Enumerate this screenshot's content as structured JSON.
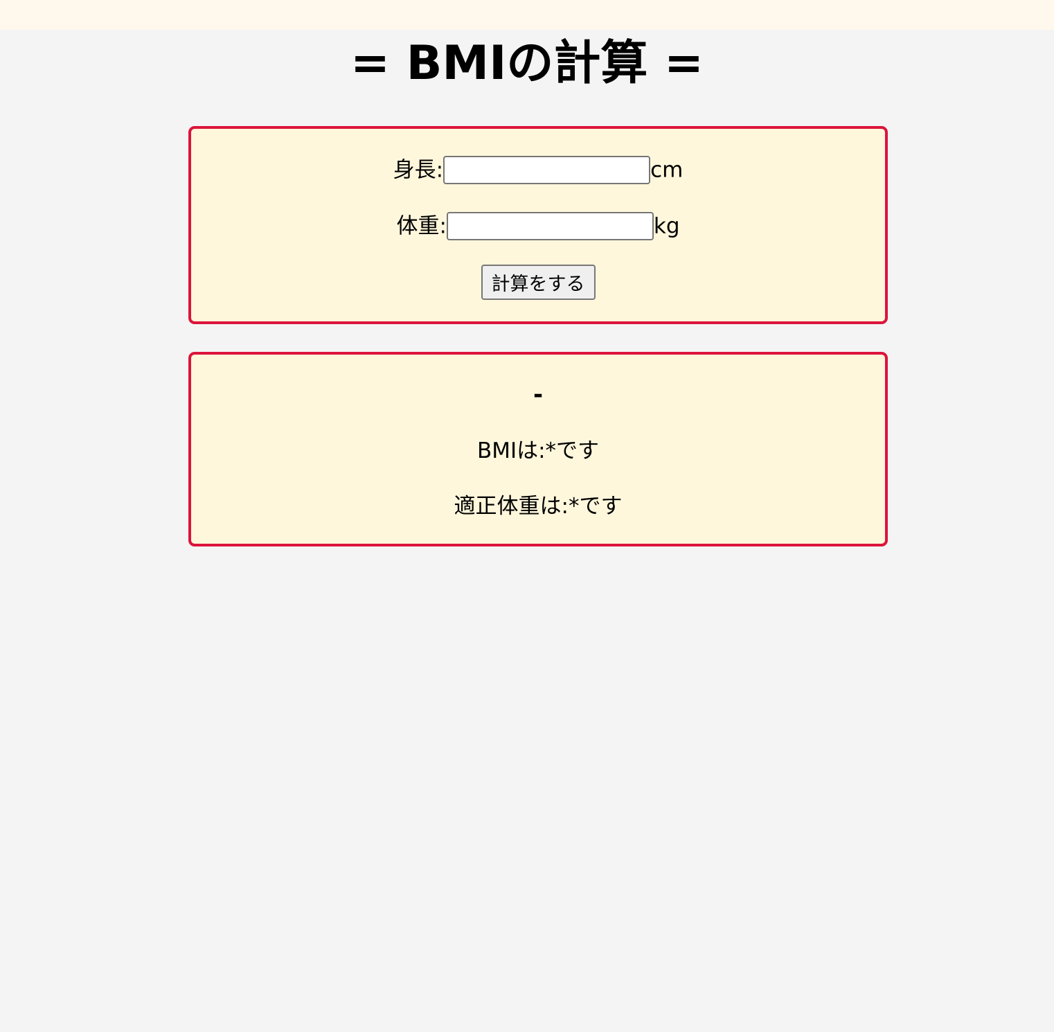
{
  "page": {
    "title": "= BMIの計算 ="
  },
  "form": {
    "height_label": "身長:",
    "height_value": "",
    "height_unit": "cm",
    "weight_label": "体重:",
    "weight_value": "",
    "weight_unit": "kg",
    "submit_label": "計算をする"
  },
  "result": {
    "status": "-",
    "bmi_text": "BMIは:*です",
    "ideal_weight_text": "適正体重は:*です"
  },
  "colors": {
    "top_strip": "#fef9ec",
    "background": "#f4f4f4",
    "panel_fill": "#fff7dc",
    "panel_border": "#dc143c"
  }
}
